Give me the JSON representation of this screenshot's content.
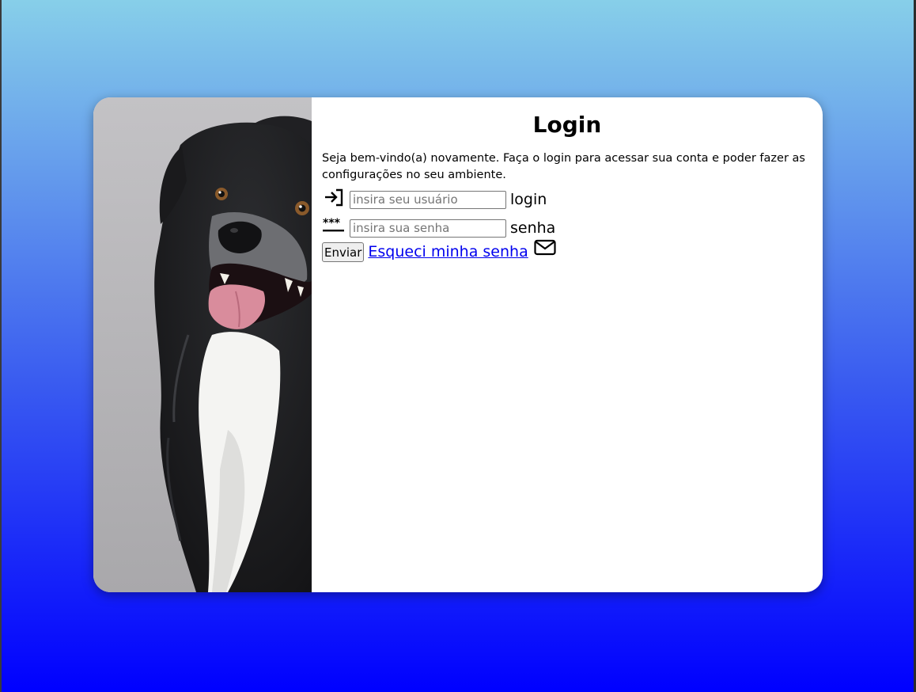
{
  "page": {
    "title": "Login",
    "intro": "Seja bem-vindo(a) novamente. Faça o login para acessar sua conta e poder fazer as configurações no seu ambiente."
  },
  "form": {
    "user": {
      "icon": "login-arrow-icon",
      "placeholder": "insira seu usuário",
      "value": "",
      "label": "login"
    },
    "password": {
      "icon": "password-asterisks-icon",
      "placeholder": "insira sua senha",
      "value": "",
      "label": "senha"
    },
    "submit_label": "Enviar",
    "forgot_label": "Esqueci minha senha",
    "forgot_icon": "envelope-icon"
  },
  "hero_image": {
    "subject": "dog-photo"
  },
  "colors": {
    "background_top": "#87cfe9",
    "background_bottom": "#0000ff",
    "card": "#ffffff",
    "link": "#0000ee"
  }
}
